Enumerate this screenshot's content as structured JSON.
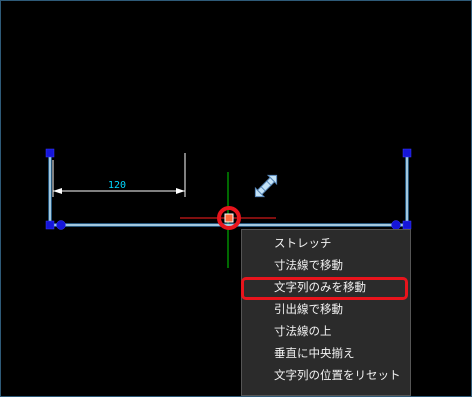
{
  "drawing": {
    "dimension_value": "120",
    "colors": {
      "background": "#000000",
      "dimension_line": "#ffffff",
      "dimension_text": "#00d7ff",
      "selected_line": "#7fd3ff",
      "grip": "#1616d9",
      "crosshair_horizontal": "#ff1e1e",
      "crosshair_vertical": "#00d000",
      "highlight": "#e8141c"
    },
    "icons": [
      "grip-handle-icon",
      "grip-dot-icon",
      "move-cursor-icon",
      "active-grip-icon"
    ]
  },
  "context_menu": {
    "items": [
      {
        "label": "ストレッチ"
      },
      {
        "label": "寸法線で移動"
      },
      {
        "label": "文字列のみを移動",
        "highlighted": true
      },
      {
        "label": "引出線で移動"
      },
      {
        "label": "寸法線の上"
      },
      {
        "label": "垂直に中央揃え"
      },
      {
        "label": "文字列の位置をリセット"
      }
    ]
  }
}
